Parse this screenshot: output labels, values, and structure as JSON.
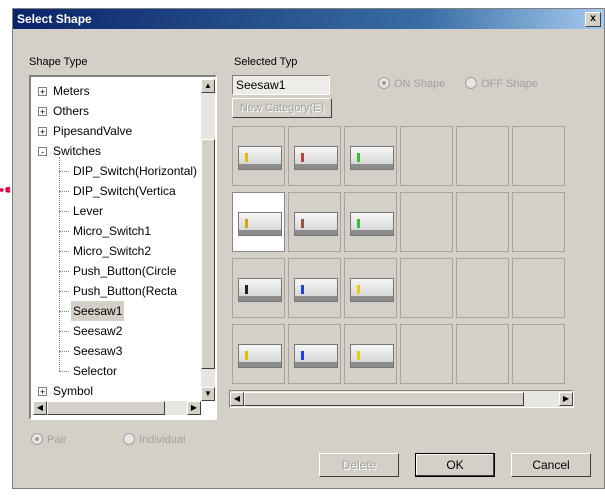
{
  "window": {
    "title": "Select Shape",
    "close_label": "x"
  },
  "shape_type": {
    "label": "Shape Type",
    "items": [
      {
        "text": "Meters",
        "level": 0,
        "expander": "+"
      },
      {
        "text": "Others",
        "level": 0,
        "expander": "+"
      },
      {
        "text": "PipesandValve",
        "level": 0,
        "expander": "+"
      },
      {
        "text": "Switches",
        "level": 0,
        "expander": "-"
      },
      {
        "text": "DIP_Switch(Horizontal)",
        "level": 1
      },
      {
        "text": "DIP_Switch(Vertica",
        "level": 1
      },
      {
        "text": "Lever",
        "level": 1
      },
      {
        "text": "Micro_Switch1",
        "level": 1
      },
      {
        "text": "Micro_Switch2",
        "level": 1
      },
      {
        "text": "Push_Button(Circle",
        "level": 1
      },
      {
        "text": "Push_Button(Recta",
        "level": 1
      },
      {
        "text": "Seesaw1",
        "level": 1,
        "selected": true
      },
      {
        "text": "Seesaw2",
        "level": 1
      },
      {
        "text": "Seesaw3",
        "level": 1
      },
      {
        "text": "Selector",
        "level": 1
      },
      {
        "text": "Symbol",
        "level": 0,
        "expander": "+"
      }
    ]
  },
  "selected_type": {
    "label": "Selected Typ",
    "value": "Seesaw1",
    "new_category_label": "New Category(E)"
  },
  "shape_options": {
    "on_label": "ON Shape",
    "off_label": "OFF Shape",
    "on_selected": true
  },
  "display_mode": {
    "pair_label": "Pair",
    "individual_label": "Individual",
    "pair_selected": true
  },
  "shape_grid": {
    "rows": [
      [
        "#e6c000",
        "#c04040",
        "#30c030",
        null,
        null,
        null
      ],
      [
        "#e0a000",
        "#a05040",
        "#30c030",
        null,
        null,
        null
      ],
      [
        "#202020",
        "#2040e0",
        "#e6d000",
        null,
        null,
        null
      ],
      [
        "#e6c000",
        "#2040e0",
        "#e6d000",
        null,
        null,
        null
      ]
    ],
    "selected_row": 1,
    "selected_col": 0
  },
  "buttons": {
    "delete_label": "Delete",
    "ok_label": "OK",
    "cancel_label": "Cancel"
  },
  "scroll_arrows": {
    "up": "▲",
    "down": "▼",
    "left": "◀",
    "right": "▶"
  }
}
